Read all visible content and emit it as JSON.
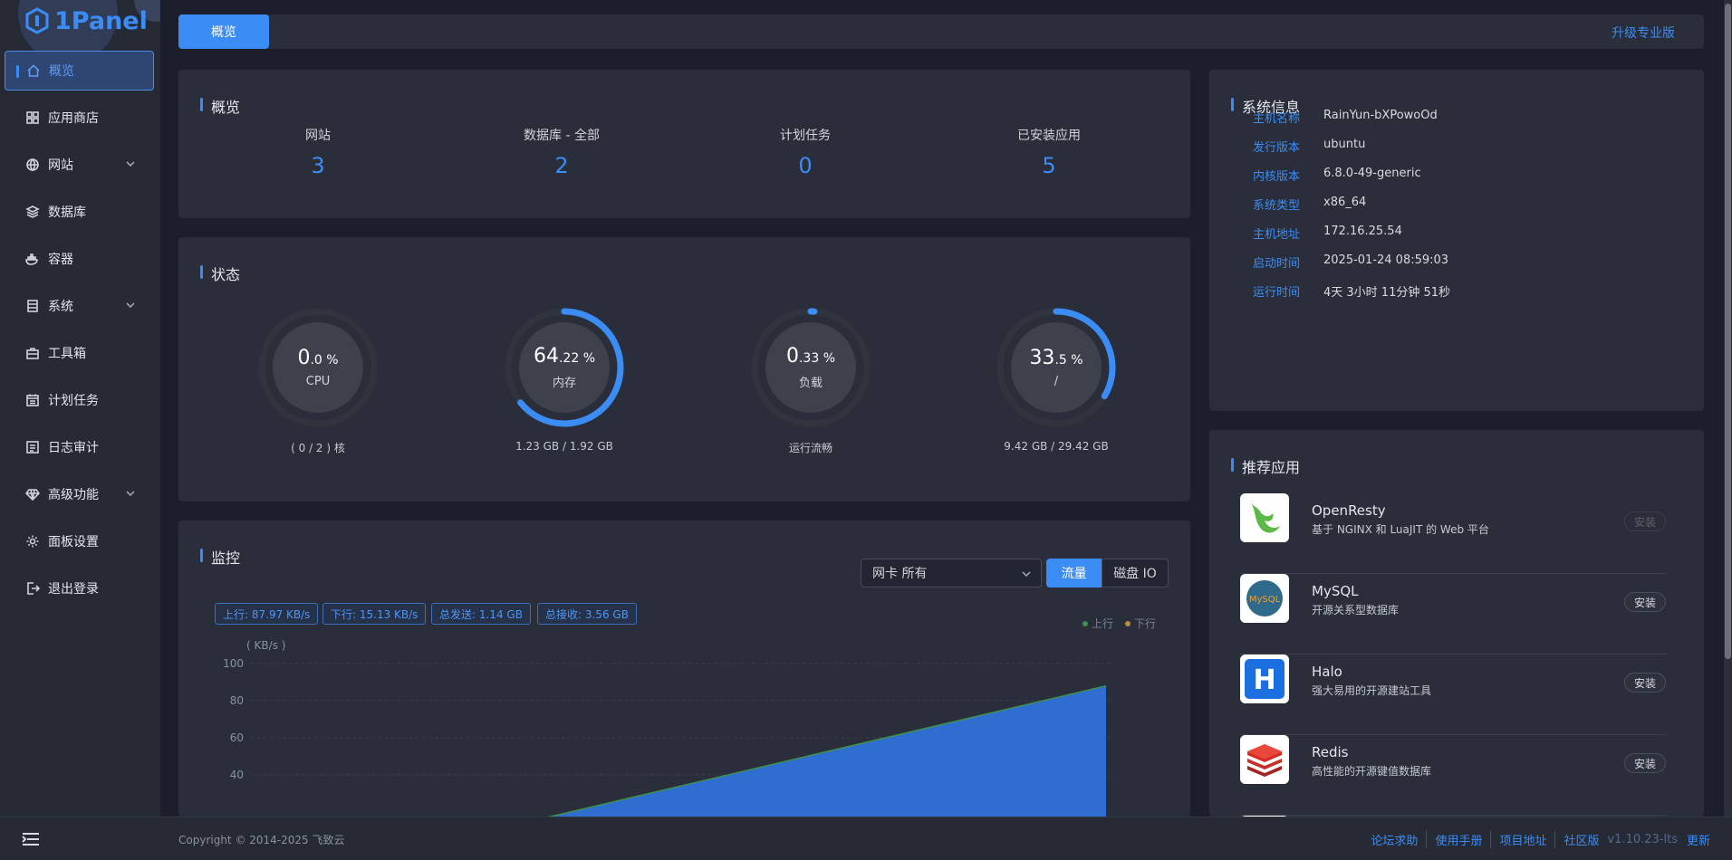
{
  "sidebar": {
    "logo": "1Panel",
    "items": [
      {
        "label": "概览",
        "icon": "home-icon"
      },
      {
        "label": "应用商店",
        "icon": "grid-icon"
      },
      {
        "label": "网站",
        "icon": "globe-icon"
      },
      {
        "label": "数据库",
        "icon": "layers-icon"
      },
      {
        "label": "容器",
        "icon": "docker-icon"
      },
      {
        "label": "系统",
        "icon": "server-icon"
      },
      {
        "label": "工具箱",
        "icon": "toolbox-icon"
      },
      {
        "label": "计划任务",
        "icon": "calendar-icon"
      },
      {
        "label": "日志审计",
        "icon": "log-icon"
      },
      {
        "label": "高级功能",
        "icon": "diamond-icon"
      },
      {
        "label": "面板设置",
        "icon": "gear-icon"
      },
      {
        "label": "退出登录",
        "icon": "logout-icon"
      }
    ]
  },
  "topbar": {
    "tab": "概览",
    "upgrade": "升级专业版"
  },
  "overview": {
    "title": "概览",
    "stats": [
      {
        "label": "网站",
        "value": "3"
      },
      {
        "label": "数据库 - 全部",
        "value": "2"
      },
      {
        "label": "计划任务",
        "value": "0"
      },
      {
        "label": "已安装应用",
        "value": "5"
      }
    ]
  },
  "status": {
    "title": "状态",
    "gauges": [
      {
        "int": "0",
        "dec": ".0 %",
        "name": "CPU",
        "foot": "( 0 / 2 ) 核",
        "percent": 0
      },
      {
        "int": "64",
        "dec": ".22 %",
        "name": "内存",
        "foot": "1.23 GB / 1.92 GB",
        "percent": 64.22
      },
      {
        "int": "0",
        "dec": ".33 %",
        "name": "负载",
        "foot": "运行流畅",
        "percent": 0.33
      },
      {
        "int": "33",
        "dec": ".5 %",
        "name": "/",
        "foot": "9.42 GB / 29.42 GB",
        "percent": 33.5
      }
    ]
  },
  "monitor": {
    "title": "监控",
    "nic_label": "网卡",
    "nic_value": "所有",
    "btn_traffic": "流量",
    "btn_disk": "磁盘 IO",
    "tags": [
      "上行: 87.97 KB/s",
      "下行: 15.13 KB/s",
      "总发送: 1.14 GB",
      "总接收: 3.56 GB"
    ],
    "legend_up": "上行",
    "legend_down": "下行",
    "unit": "( KB/s )",
    "colors": {
      "up": "#3f8f4f",
      "down": "#b58f3a",
      "area": "#2f6dd0"
    }
  },
  "chart_data": {
    "type": "area",
    "ylabel": "( KB/s )",
    "yticks": [
      40,
      60,
      80,
      100
    ],
    "ylim": [
      0,
      100
    ],
    "series": [
      {
        "name": "上行",
        "x": [
          0,
          1
        ],
        "values": [
          0,
          87.97
        ]
      },
      {
        "name": "下行",
        "x": [
          0,
          1
        ],
        "values": [
          0,
          15.13
        ]
      }
    ]
  },
  "sysinfo": {
    "title": "系统信息",
    "rows": [
      {
        "k": "主机名称",
        "v": "RainYun-bXPowoOd"
      },
      {
        "k": "发行版本",
        "v": "ubuntu"
      },
      {
        "k": "内核版本",
        "v": "6.8.0-49-generic"
      },
      {
        "k": "系统类型",
        "v": "x86_64"
      },
      {
        "k": "主机地址",
        "v": "172.16.25.54"
      },
      {
        "k": "启动时间",
        "v": "2025-01-24 08:59:03"
      },
      {
        "k": "运行时间",
        "v": "4天 3小时 11分钟 51秒"
      }
    ]
  },
  "apps": {
    "title": "推荐应用",
    "items": [
      {
        "name": "OpenResty",
        "desc": "基于 NGINX 和 LuaJIT 的 Web 平台",
        "btn": "安装",
        "disabled": true
      },
      {
        "name": "MySQL",
        "desc": "开源关系型数据库",
        "btn": "安装",
        "disabled": false
      },
      {
        "name": "Halo",
        "desc": "强大易用的开源建站工具",
        "btn": "安装",
        "disabled": false
      },
      {
        "name": "Redis",
        "desc": "高性能的开源键值数据库",
        "btn": "安装",
        "disabled": false
      }
    ]
  },
  "footer": {
    "copyright": "Copyright © 2014-2025 飞致云",
    "links": [
      "论坛求助",
      "使用手册",
      "项目地址",
      "社区版"
    ],
    "version": "v1.10.23-lts",
    "update": "更新"
  }
}
